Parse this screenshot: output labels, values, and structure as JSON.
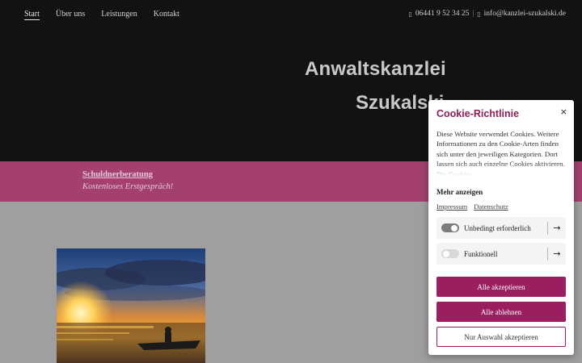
{
  "nav": {
    "items": [
      {
        "label": "Start"
      },
      {
        "label": "Über uns"
      },
      {
        "label": "Leistungen"
      },
      {
        "label": "Kontakt"
      }
    ]
  },
  "contact": {
    "phone_icon": "phone-icon",
    "phone": "06441 9 52 34 25",
    "separator": "|",
    "mail_icon": "envelope-icon",
    "email": "info@kanzlei-szukalski.de"
  },
  "hero": {
    "title": "Anwaltskanzlei",
    "subtitle": "Szukalski"
  },
  "band": {
    "link": "Schuldnerberatung",
    "text": "Kostenloses Erstgespräch!",
    "color": "#a3406f"
  },
  "cookie": {
    "title": "Cookie-Richtlinie",
    "close": "×",
    "text": "Diese Website verwendet Cookies. Weitere Informationen zu den Cookie-Arten finden sich unter den jeweiligen Kategorien. Dort lassen sich auch einzelne Cookies aktivieren. Die Cookie-",
    "more": "Mehr anzeigen",
    "links": [
      "Impressum",
      "Datenschutz"
    ],
    "categories": [
      {
        "label": "Unbedingt erforderlich",
        "enabled": true
      },
      {
        "label": "Funktionell",
        "enabled": false
      }
    ],
    "arrow": "→",
    "buttons": {
      "accept_all": "Alle akzeptieren",
      "reject_all": "Alle ablehnen",
      "accept_selection": "Nur Auswahl akzeptieren"
    },
    "accent": "#9b1f5e"
  }
}
